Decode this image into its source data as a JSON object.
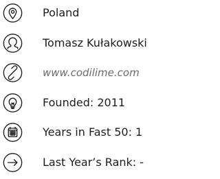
{
  "company_info": {
    "location": {
      "icon": "location-pin-icon",
      "text": "Poland"
    },
    "ceo": {
      "icon": "person-icon",
      "text": "Tomasz Kułakowski"
    },
    "website": {
      "icon": "link-icon",
      "text": "www.codilime.com"
    },
    "founded": {
      "icon": "lightbulb-icon",
      "text": "Founded: 2011"
    },
    "years_in_fast50": {
      "icon": "calendar-icon",
      "text": "Years in Fast 50: 1"
    },
    "last_year_rank": {
      "icon": "arrow-right-icon",
      "text": "Last Year’s Rank:  -"
    }
  },
  "colors": {
    "icon_stroke": "#1d1d1f",
    "text": "#1d1d1f",
    "link_text": "#6b6b6b",
    "background": "#ffffff"
  }
}
